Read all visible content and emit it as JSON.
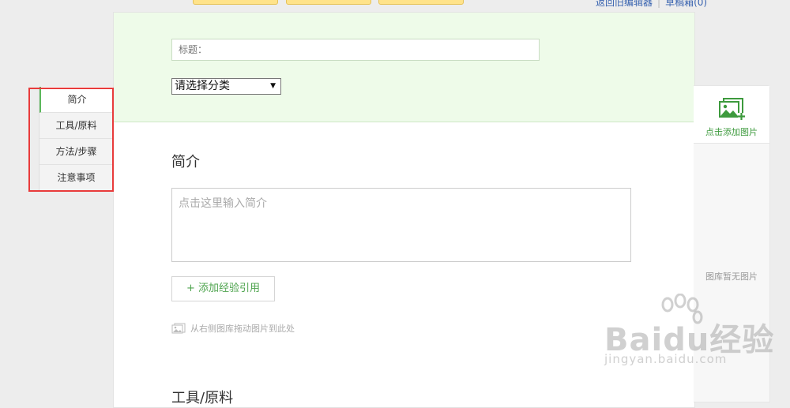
{
  "top_bar": {
    "links": [
      "返回旧编辑器",
      "草稿箱(0)"
    ]
  },
  "editor": {
    "title_placeholder": "标题：",
    "category_selected": "请选择分类",
    "intro_heading": "简介",
    "intro_placeholder": "点击这里输入简介",
    "add_reference_label": "+ 添加经验引用",
    "drag_hint": "从右侧图库拖动图片到此处",
    "next_heading": "工具/原料"
  },
  "nav": {
    "items": [
      {
        "label": "简介",
        "active": true
      },
      {
        "label": "工具/原料",
        "active": false
      },
      {
        "label": "方法/步骤",
        "active": false
      },
      {
        "label": "注意事项",
        "active": false
      }
    ]
  },
  "gallery": {
    "add_label": "点击添加图片",
    "empty_text": "图库暂无图片"
  },
  "watermark": {
    "brand": "Baidu经验",
    "url": "jingyan.baidu.com"
  },
  "colors": {
    "accent_green": "#4fa44f",
    "highlight_red": "#e83b3b",
    "header_bg": "#eefbe9"
  }
}
